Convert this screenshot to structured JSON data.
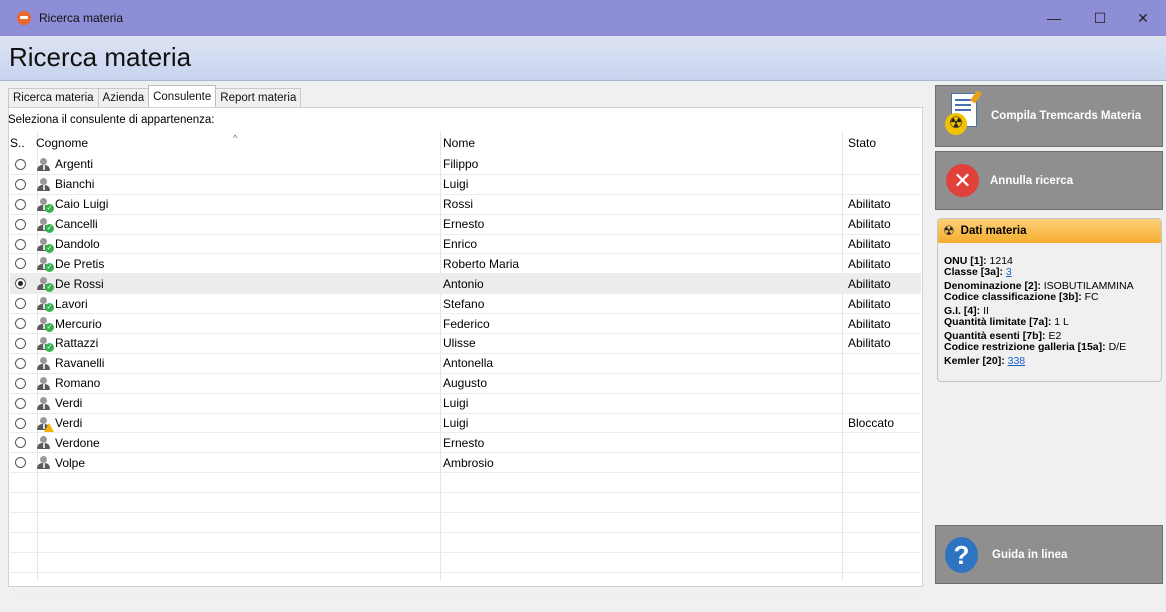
{
  "window": {
    "title": "Ricerca materia",
    "controls": [
      "—",
      "☐",
      "✕"
    ]
  },
  "header": {
    "title": "Ricerca materia"
  },
  "tabs": [
    {
      "label": "Ricerca materia",
      "active": false
    },
    {
      "label": "Azienda",
      "active": false
    },
    {
      "label": "Consulente",
      "active": true
    },
    {
      "label": "Report materia",
      "active": false
    }
  ],
  "prompt": "Seleziona il consulente di appartenenza:",
  "table": {
    "columns": [
      "S..",
      "Cognome",
      "Nome",
      "Stato"
    ],
    "sort_indicator": "^",
    "rows": [
      {
        "cognome": "Argenti",
        "nome": "Filippo",
        "stato": "",
        "status": "normal",
        "selected": false
      },
      {
        "cognome": "Bianchi",
        "nome": "Luigi",
        "stato": "",
        "status": "normal",
        "selected": false
      },
      {
        "cognome": "Caio Luigi",
        "nome": "Rossi",
        "stato": "Abilitato",
        "status": "ok",
        "selected": false
      },
      {
        "cognome": "Cancelli",
        "nome": "Ernesto",
        "stato": "Abilitato",
        "status": "ok",
        "selected": false
      },
      {
        "cognome": "Dandolo",
        "nome": "Enrico",
        "stato": "Abilitato",
        "status": "ok",
        "selected": false
      },
      {
        "cognome": "De Pretis",
        "nome": "Roberto Maria",
        "stato": "Abilitato",
        "status": "ok",
        "selected": false
      },
      {
        "cognome": "De Rossi",
        "nome": "Antonio",
        "stato": "Abilitato",
        "status": "ok",
        "selected": true
      },
      {
        "cognome": "Lavori",
        "nome": "Stefano",
        "stato": "Abilitato",
        "status": "ok",
        "selected": false
      },
      {
        "cognome": "Mercurio",
        "nome": "Federico",
        "stato": "Abilitato",
        "status": "ok",
        "selected": false
      },
      {
        "cognome": "Rattazzi",
        "nome": "Ulisse",
        "stato": "Abilitato",
        "status": "ok",
        "selected": false
      },
      {
        "cognome": "Ravanelli",
        "nome": "Antonella",
        "stato": "",
        "status": "normal",
        "selected": false
      },
      {
        "cognome": "Romano",
        "nome": "Augusto",
        "stato": "",
        "status": "normal",
        "selected": false
      },
      {
        "cognome": "Verdi",
        "nome": "Luigi",
        "stato": "",
        "status": "normal",
        "selected": false
      },
      {
        "cognome": "Verdi",
        "nome": "Luigi",
        "stato": "Bloccato",
        "status": "warn",
        "selected": false
      },
      {
        "cognome": "Verdone",
        "nome": "Ernesto",
        "stato": "",
        "status": "normal",
        "selected": false
      },
      {
        "cognome": "Volpe",
        "nome": "Ambrosio",
        "stato": "",
        "status": "normal",
        "selected": false
      }
    ],
    "empty_rows": 7
  },
  "sidebar": {
    "compile_button": "Compila Tremcards Materia",
    "cancel_button": "Annulla ricerca",
    "help_button": "Guida in linea",
    "info_title": "Dati materia",
    "info": [
      {
        "label": "ONU [1]",
        "value": "1214",
        "link": false,
        "gap": false
      },
      {
        "label": "Classe [3a]",
        "value": "3",
        "link": true,
        "gap": false
      },
      {
        "label": "Denominazione [2]",
        "value": "ISOBUTILAMMINA",
        "link": false,
        "gap": true
      },
      {
        "label": "Codice classificazione [3b]",
        "value": "FC",
        "link": false,
        "gap": false
      },
      {
        "label": "G.I. [4]",
        "value": "II",
        "link": false,
        "gap": true
      },
      {
        "label": "Quantità limitate [7a]",
        "value": "1 L",
        "link": false,
        "gap": false
      },
      {
        "label": "Quantità esenti [7b]",
        "value": "E2",
        "link": false,
        "gap": true
      },
      {
        "label": "Codice restrizione galleria [15a]",
        "value": "D/E",
        "link": false,
        "gap": false
      },
      {
        "label": "Kemler [20]",
        "value": "338",
        "link": true,
        "gap": true
      }
    ]
  },
  "colors": {
    "titlebar": "#8e8ed6",
    "button_gray": "#8f8f8f",
    "info_header": "#f5ad2e",
    "link": "#1a5fc8"
  }
}
